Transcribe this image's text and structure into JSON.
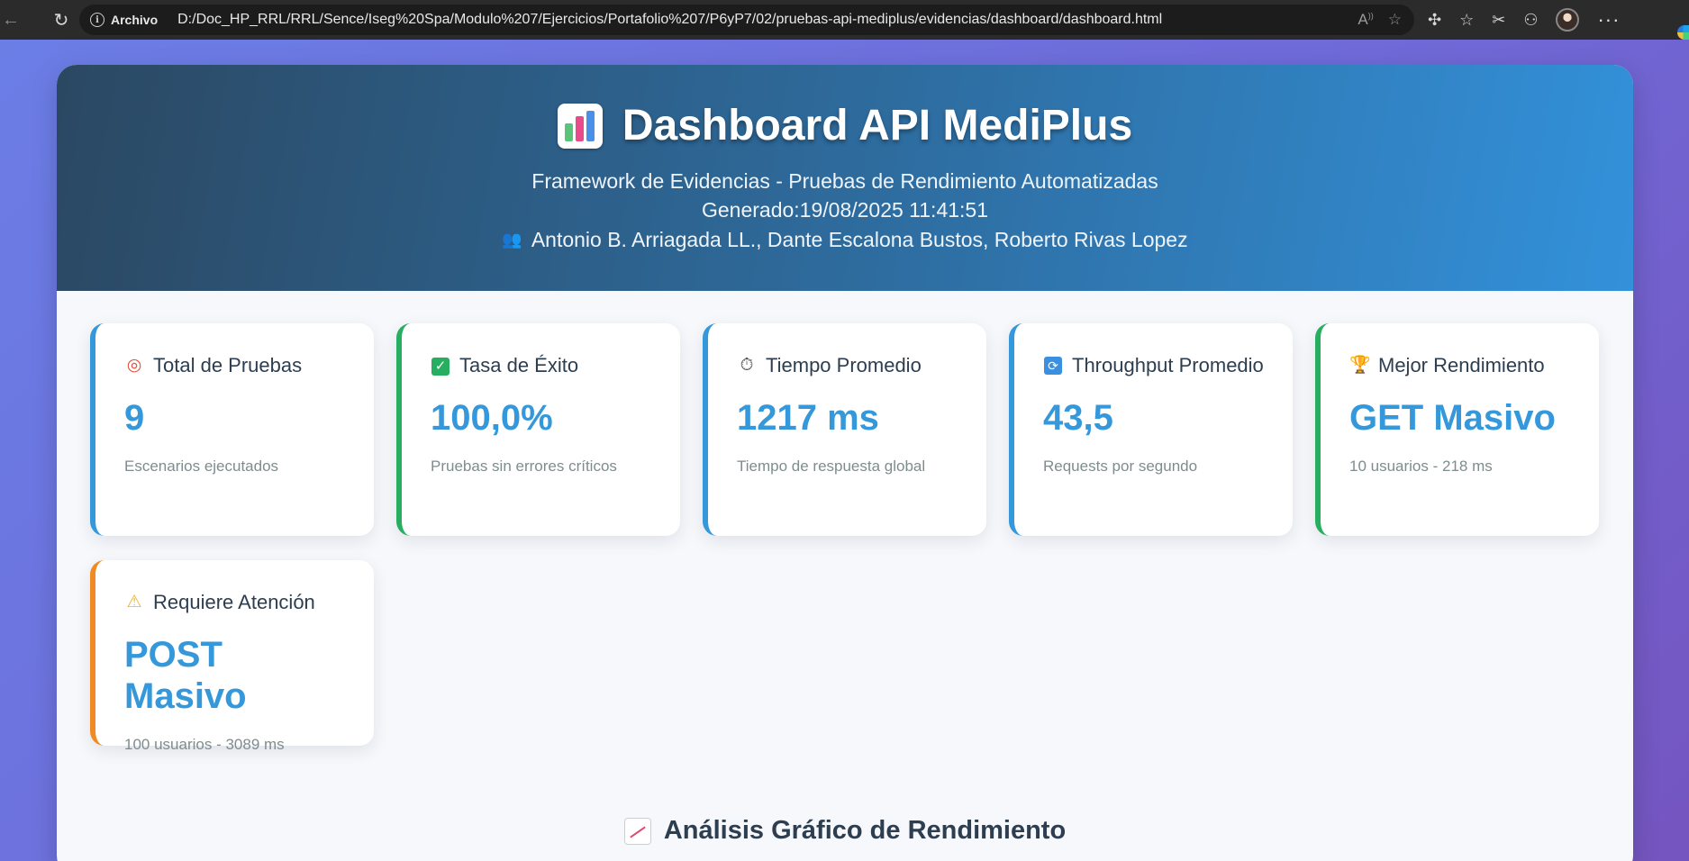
{
  "browser": {
    "address_label": "Archivo",
    "url": "D:/Doc_HP_RRL/RRL/Sence/Iseg%20Spa/Modulo%207/Ejercicios/Portafolio%207/P6yP7/02/pruebas-api-mediplus/evidencias/dashboard/dashboard.html"
  },
  "header": {
    "title": "Dashboard API MediPlus",
    "subtitle": "Framework de Evidencias - Pruebas de Rendimiento Automatizadas",
    "generated": "Generado:19/08/2025 11:41:51",
    "authors": "Antonio B. Arriagada LL., Dante Escalona Bustos, Roberto Rivas Lopez"
  },
  "cards": [
    {
      "icon": "target-icon",
      "title": "Total de Pruebas",
      "value": "9",
      "desc": "Escenarios ejecutados",
      "accent": "#3498db"
    },
    {
      "icon": "check-icon",
      "title": "Tasa de Éxito",
      "value": "100,0%",
      "desc": "Pruebas sin errores críticos",
      "accent": "#27ae60"
    },
    {
      "icon": "stopwatch-icon",
      "title": "Tiempo Promedio",
      "value": "1217 ms",
      "desc": "Tiempo de respuesta global",
      "accent": "#3498db"
    },
    {
      "icon": "refresh-icon",
      "title": "Throughput Promedio",
      "value": "43,5",
      "desc": "Requests por segundo",
      "accent": "#3498db"
    },
    {
      "icon": "trophy-icon",
      "title": "Mejor Rendimiento",
      "value": "GET Masivo",
      "desc": "10 usuarios - 218 ms",
      "accent": "#27ae60"
    },
    {
      "icon": "warning-icon",
      "title": "Requiere Atención",
      "value": "POST Masivo",
      "desc": "100 usuarios - 3089 ms",
      "accent": "#f08a24"
    }
  ],
  "section": {
    "title": "Análisis Gráfico de Rendimiento"
  },
  "colors": {
    "header_start": "#2b4862",
    "header_end": "#3391da",
    "value_blue": "#3498db",
    "success_green": "#27ae60",
    "warning_orange": "#f08a24"
  }
}
